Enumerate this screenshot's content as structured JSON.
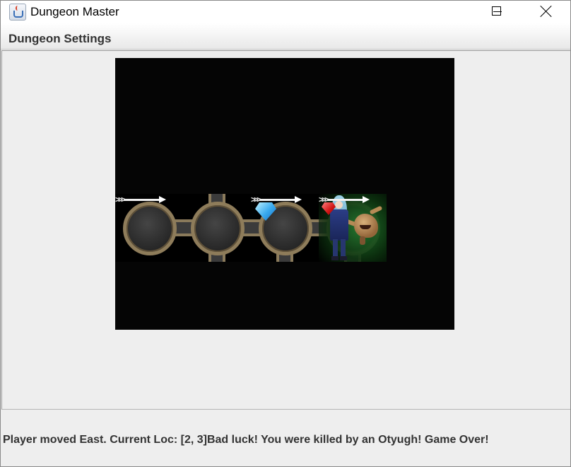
{
  "window": {
    "title": "Dungeon Master",
    "icon": "java-cup-icon",
    "controls": [
      "minimize-icon",
      "maximize-icon",
      "close-icon"
    ]
  },
  "menu": {
    "items": [
      "Dungeon Settings"
    ]
  },
  "dungeon": {
    "tiles": [
      {
        "room": "cave",
        "exits": [
          "east"
        ],
        "arrow": true,
        "treasure": null,
        "player": false,
        "monster": null
      },
      {
        "room": "cave",
        "exits": [
          "north",
          "south",
          "east",
          "west"
        ],
        "arrow": false,
        "treasure": null,
        "player": false,
        "monster": null
      },
      {
        "room": "cave",
        "exits": [
          "south",
          "east",
          "west"
        ],
        "arrow": true,
        "treasure": "sapphire",
        "player": false,
        "monster": null
      },
      {
        "room": "cave",
        "exits": [
          "south",
          "west"
        ],
        "arrow": true,
        "treasure": "ruby",
        "player": true,
        "monster": "otyugh"
      }
    ]
  },
  "status": {
    "message": "Player moved East. Current Loc: [2, 3]Bad luck! You were killed by an Otyugh! Game Over!"
  }
}
